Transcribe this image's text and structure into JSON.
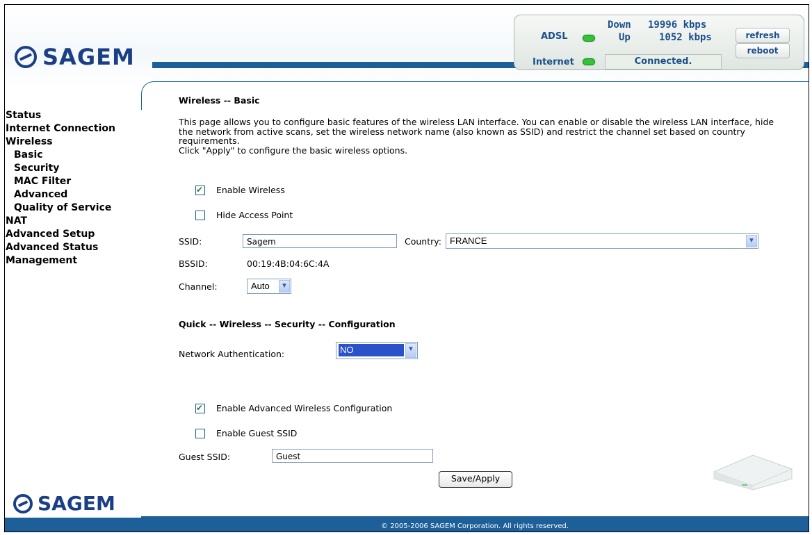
{
  "brand": {
    "name": "SAGEM"
  },
  "status_panel": {
    "adsl_label": "ADSL",
    "internet_label": "Internet",
    "down_label": "Down",
    "down_rate": "19996 kbps",
    "up_label": "Up",
    "up_rate": "1052 kbps",
    "connection_status": "Connected.",
    "refresh_label": "refresh",
    "reboot_label": "reboot",
    "led_color": "#33c23a"
  },
  "sidebar": {
    "items": [
      {
        "label": "Status",
        "level": "top"
      },
      {
        "label": "Internet Connection",
        "level": "top"
      },
      {
        "label": "Wireless",
        "level": "top"
      },
      {
        "label": "Basic",
        "level": "sub"
      },
      {
        "label": "Security",
        "level": "sub"
      },
      {
        "label": "MAC Filter",
        "level": "sub"
      },
      {
        "label": "Advanced",
        "level": "sub"
      },
      {
        "label": "Quality of Service",
        "level": "sub"
      },
      {
        "label": "NAT",
        "level": "top"
      },
      {
        "label": "Advanced Setup",
        "level": "top"
      },
      {
        "label": "Advanced Status",
        "level": "top"
      },
      {
        "label": "Management",
        "level": "top"
      }
    ]
  },
  "main": {
    "title": "Wireless -- Basic",
    "description": "This page allows you to configure basic features of the wireless LAN interface. You can enable or disable the wireless LAN interface, hide the network from active scans, set the wireless network name (also known as SSID) and restrict the channel set based on country requirements.",
    "description_apply": "Click \"Apply\" to configure the basic wireless options.",
    "enable_wireless_label": "Enable Wireless",
    "enable_wireless_checked": true,
    "hide_ap_label": "Hide Access Point",
    "hide_ap_checked": false,
    "ssid_label": "SSID:",
    "ssid_value": "Sagem",
    "country_label": "Country:",
    "country_value": "FRANCE",
    "bssid_label": "BSSID:",
    "bssid_value": "00:19:4B:04:6C:4A",
    "channel_label": "Channel:",
    "channel_value": "Auto",
    "quick_title": "Quick -- Wireless -- Security -- Configuration",
    "net_auth_label": "Network Authentication:",
    "net_auth_value": "NO",
    "adv_wireless_label": "Enable Advanced Wireless Configuration",
    "adv_wireless_checked": true,
    "guest_enable_label": "Enable Guest SSID",
    "guest_enable_checked": false,
    "guest_ssid_label": "Guest SSID:",
    "guest_ssid_value": "Guest",
    "save_label": "Save/Apply"
  },
  "footer": {
    "copyright": "© 2005-2006 SAGEM Corporation. All rights reserved."
  },
  "colors": {
    "brand_blue": "#1c5f99",
    "logo_blue": "#1b3f86",
    "status_text": "#1b4f8a"
  }
}
